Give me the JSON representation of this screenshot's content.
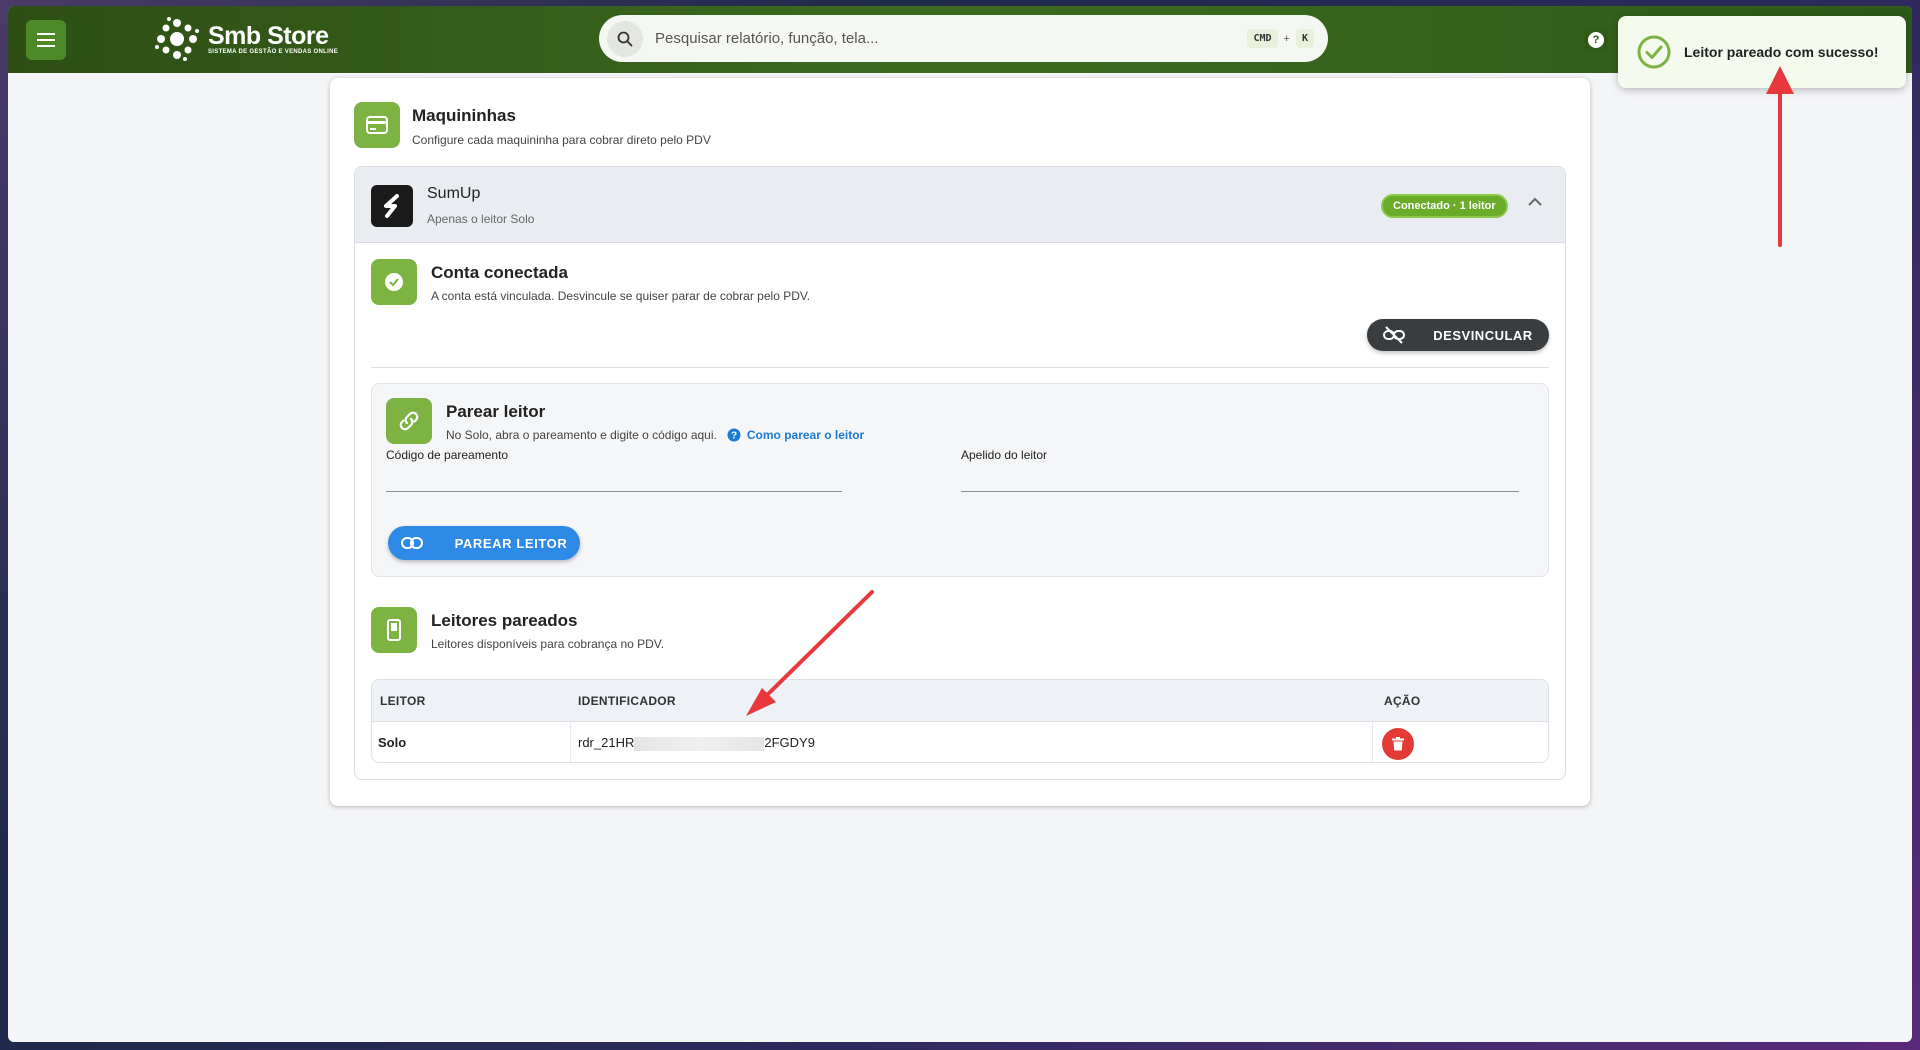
{
  "brand": {
    "title": "Smb Store",
    "subtitle": "SISTEMA DE GESTÃO E VENDAS ONLINE"
  },
  "search": {
    "placeholder": "Pesquisar relatório, função, tela...",
    "kbd_cmd": "CMD",
    "kbd_plus": "+",
    "kbd_k": "K"
  },
  "help": {
    "label": "?"
  },
  "toast": {
    "message": "Leitor pareado com sucesso!"
  },
  "page": {
    "title": "Maquininhas",
    "subtitle": "Configure cada maquininha para cobrar direto pelo PDV"
  },
  "provider": {
    "name": "SumUp",
    "subtitle": "Apenas o leitor Solo",
    "status": "Conectado · 1 leitor"
  },
  "account": {
    "title": "Conta conectada",
    "subtitle": "A conta está vinculada. Desvincule se quiser parar de cobrar pelo PDV.",
    "unlink_label": "DESVINCULAR"
  },
  "pair": {
    "title": "Parear leitor",
    "subtitle": "No Solo, abra o pareamento e digite o código aqui.",
    "help_link": "Como parear o leitor",
    "code_label": "Código de pareamento",
    "code_value": "",
    "nickname_label": "Apelido do leitor",
    "nickname_value": "",
    "button_label": "PAREAR LEITOR"
  },
  "readers": {
    "title": "Leitores pareados",
    "subtitle": "Leitores disponíveis para cobrança no PDV.",
    "columns": [
      "LEITOR",
      "IDENTIFICADOR",
      "AÇÃO"
    ],
    "rows": [
      {
        "reader": "Solo",
        "id_prefix": "rdr_21HR",
        "id_suffix": "2FGDY9"
      }
    ]
  },
  "colors": {
    "accent_green": "#7cb342",
    "topbar": "#3c6b1f",
    "danger": "#e53935",
    "primary_blue": "#2d8ae6",
    "annotation_red": "#e8383d"
  }
}
